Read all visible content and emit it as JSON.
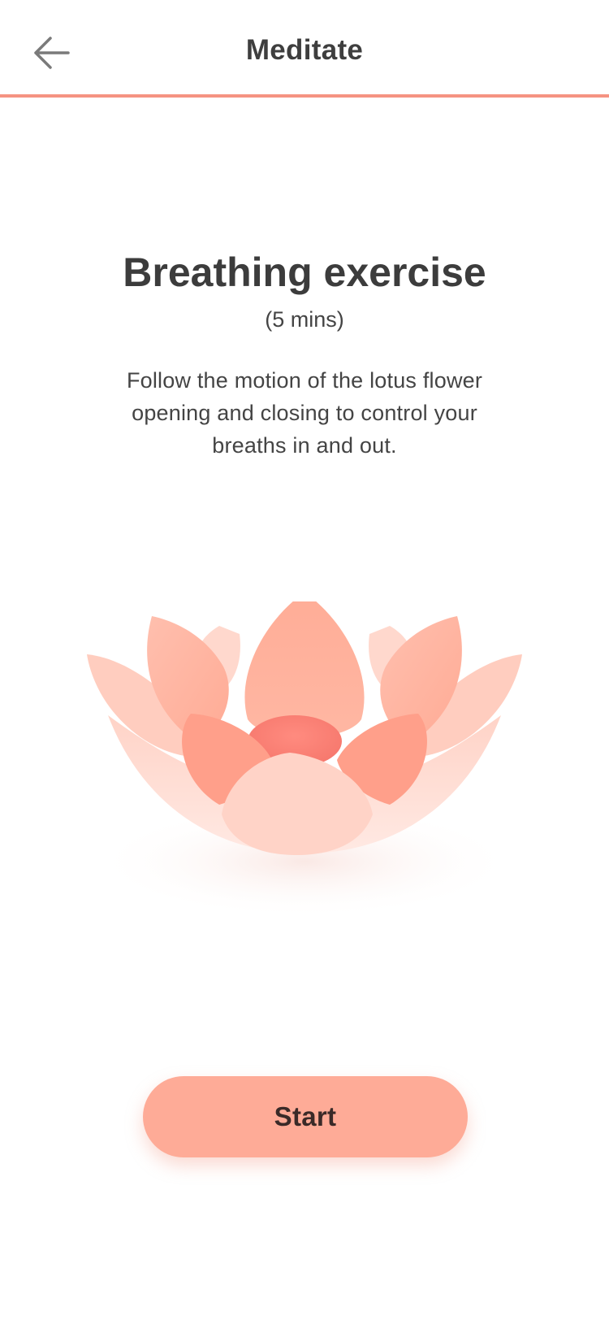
{
  "header": {
    "title": "Meditate",
    "back_icon": "arrow-left-icon",
    "accent_color": "#f59382"
  },
  "exercise": {
    "title": "Breathing exercise",
    "duration": "(5 mins)",
    "description": "Follow the motion of the lotus flower opening and closing to control your breaths in and out."
  },
  "illustration": {
    "name": "lotus-flower",
    "petal_color": "#ffb09e"
  },
  "actions": {
    "start_label": "Start",
    "button_color": "#feab97"
  }
}
